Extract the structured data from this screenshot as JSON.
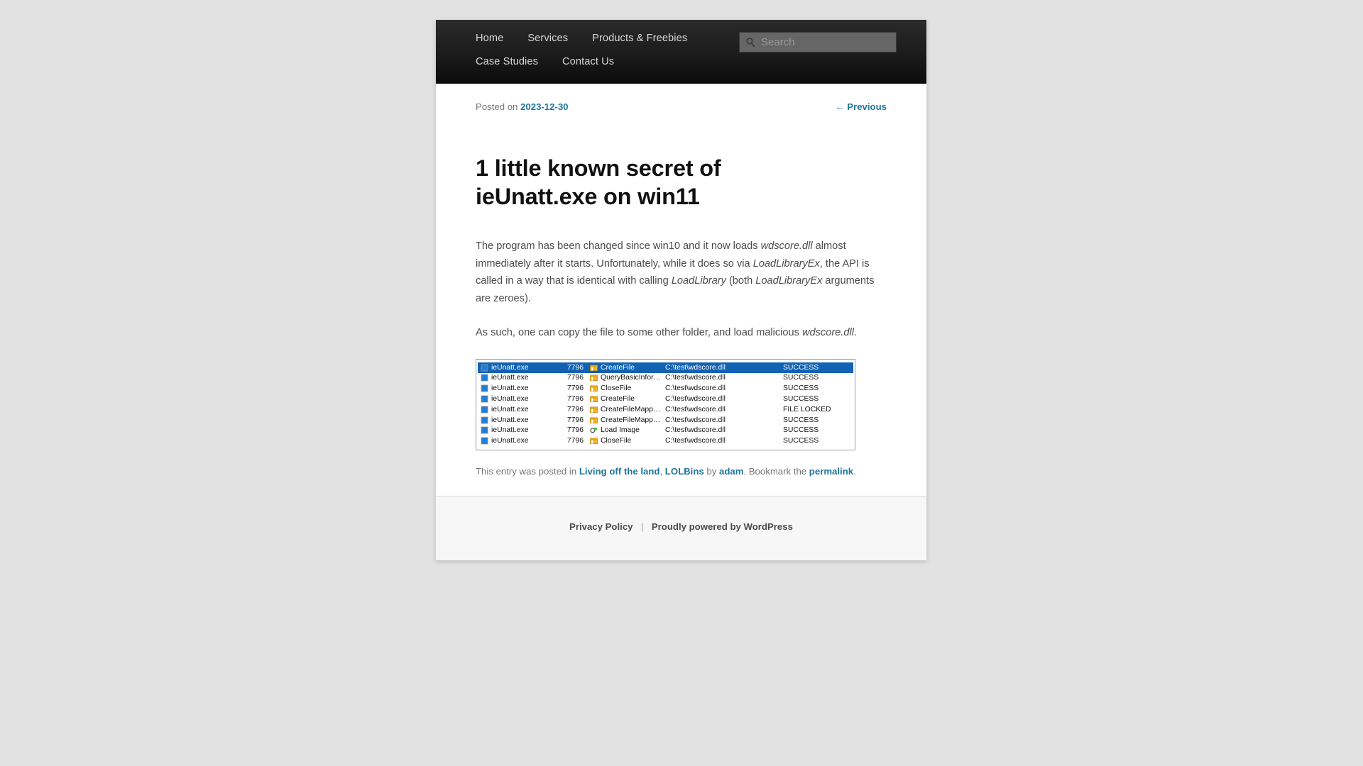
{
  "nav": {
    "rows": [
      [
        {
          "label": "Home",
          "name": "nav-item-home"
        },
        {
          "label": "Services",
          "name": "nav-item-services"
        },
        {
          "label": "Products & Freebies",
          "name": "nav-item-products-freebies"
        }
      ],
      [
        {
          "label": "Case Studies",
          "name": "nav-item-case-studies"
        },
        {
          "label": "Contact Us",
          "name": "nav-item-contact-us"
        }
      ]
    ]
  },
  "search": {
    "placeholder": "Search",
    "value": "",
    "icon": "search-icon"
  },
  "entry": {
    "posted_on_label": "Posted on",
    "date": "2023-12-30",
    "previous_label": "← Previous",
    "title": "1 little known secret of ieUnatt.exe on win11",
    "paragraph1_part1": "The program has been changed since win10 and it now loads ",
    "paragraph1_em1": "wdscore.dll",
    "paragraph1_part2": " almost immediately after it starts. Unfortunately, while it does so via ",
    "paragraph1_em2": "LoadLibraryEx",
    "paragraph1_part3": ", the API is called in a way that is identical with calling ",
    "paragraph1_em3": "LoadLibrary",
    "paragraph1_part4": " (both ",
    "paragraph1_em4": "LoadLibraryEx",
    "paragraph1_part5": " arguments are zeroes).",
    "paragraph2_part1": "As such, one can copy the file to some other folder, and load malicious ",
    "paragraph2_em1": "wdscore.dll",
    "paragraph2_part2": "."
  },
  "procmon": {
    "selected_row_color": "#1262b3",
    "rows": [
      {
        "process": "ieUnatt.exe",
        "pid": "7796",
        "operation": "CreateFile",
        "path": "C:\\test\\wdscore.dll",
        "result": "SUCCESS",
        "icon": "file-icon",
        "selected": true
      },
      {
        "process": "ieUnatt.exe",
        "pid": "7796",
        "operation": "QueryBasicInfor…",
        "path": "C:\\test\\wdscore.dll",
        "result": "SUCCESS",
        "icon": "folder-icon",
        "selected": false
      },
      {
        "process": "ieUnatt.exe",
        "pid": "7796",
        "operation": "CloseFile",
        "path": "C:\\test\\wdscore.dll",
        "result": "SUCCESS",
        "icon": "folder-icon",
        "selected": false
      },
      {
        "process": "ieUnatt.exe",
        "pid": "7796",
        "operation": "CreateFile",
        "path": "C:\\test\\wdscore.dll",
        "result": "SUCCESS",
        "icon": "folder-icon",
        "selected": false
      },
      {
        "process": "ieUnatt.exe",
        "pid": "7796",
        "operation": "CreateFileMapp…",
        "path": "C:\\test\\wdscore.dll",
        "result": "FILE LOCKED",
        "icon": "folder-icon",
        "selected": false
      },
      {
        "process": "ieUnatt.exe",
        "pid": "7796",
        "operation": "CreateFileMapp…",
        "path": "C:\\test\\wdscore.dll",
        "result": "SUCCESS",
        "icon": "folder-icon",
        "selected": false
      },
      {
        "process": "ieUnatt.exe",
        "pid": "7796",
        "operation": "Load Image",
        "path": "C:\\test\\wdscore.dll",
        "result": "SUCCESS",
        "icon": "load-image-icon",
        "selected": false
      },
      {
        "process": "ieUnatt.exe",
        "pid": "7796",
        "operation": "CloseFile",
        "path": "C:\\test\\wdscore.dll",
        "result": "SUCCESS",
        "icon": "folder-icon",
        "selected": false
      }
    ]
  },
  "meta": {
    "text_posted_in": "This entry was posted in ",
    "cat1": "Living off the land",
    "comma": ", ",
    "cat2": "LOLBins",
    "text_by": " by ",
    "author": "adam",
    "text_bookmark": ". Bookmark the ",
    "permalink": "permalink",
    "period": "."
  },
  "colophon": {
    "privacy": "Privacy Policy",
    "separator": "|",
    "powered": "Proudly powered by WordPress"
  },
  "colors": {
    "link": "#21759b",
    "nav_bg_top": "#2b2b2b",
    "nav_bg_bottom": "#0c0c0c",
    "page_bg": "#e2e2e2"
  }
}
